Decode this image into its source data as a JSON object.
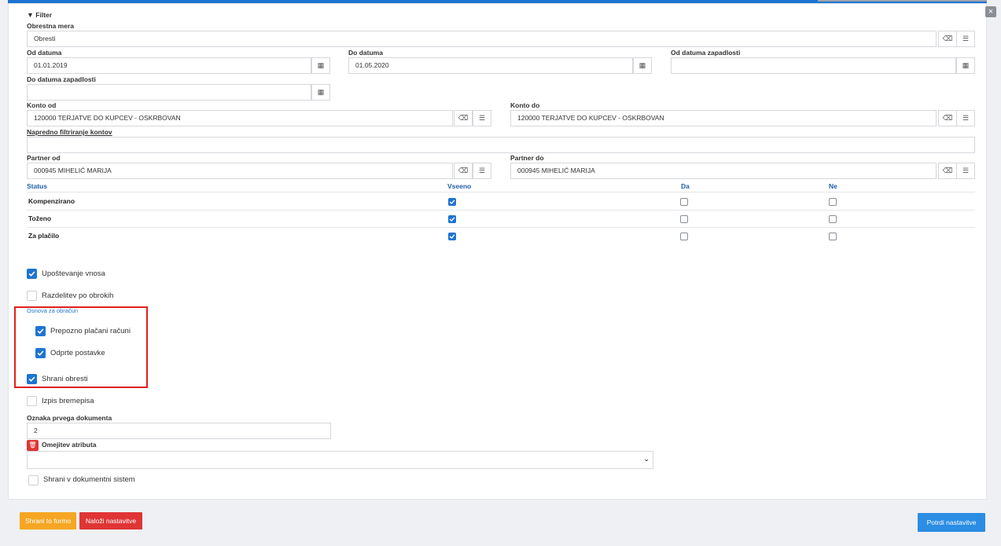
{
  "window": {
    "close_label": "×"
  },
  "filter": {
    "header": "Filter",
    "obrestna_mera": {
      "label": "Obrestna mera",
      "value": "Obresti"
    },
    "od_datuma": {
      "label": "Od datuma",
      "value": "01.01.2019"
    },
    "do_datuma": {
      "label": "Do datuma",
      "value": "01.05.2020"
    },
    "od_datuma_zapadlosti": {
      "label": "Od datuma zapadlosti",
      "value": ""
    },
    "do_datuma_zapadlosti": {
      "label": "Do datuma zapadlosti",
      "value": ""
    },
    "konto_od": {
      "label": "Konto od",
      "value": "120000 TERJATVE DO KUPCEV - OSKRBOVAN"
    },
    "konto_do": {
      "label": "Konto do",
      "value": "120000 TERJATVE DO KUPCEV - OSKRBOVAN"
    },
    "napredno": {
      "label": "Napredno filtriranje kontov",
      "value": ""
    },
    "partner_od": {
      "label": "Partner od",
      "value": "000945 MIHELIĆ MARIJA"
    },
    "partner_do": {
      "label": "Partner do",
      "value": "000945 MIHELIĆ MARIJA"
    }
  },
  "status_table": {
    "headers": {
      "status": "Status",
      "vseeno": "Vseeno",
      "da": "Da",
      "ne": "Ne"
    },
    "rows": [
      {
        "label": "Kompenzirano",
        "vseeno": true,
        "da": false,
        "ne": false
      },
      {
        "label": "Toženo",
        "vseeno": true,
        "da": false,
        "ne": false
      },
      {
        "label": "Za plačilo",
        "vseeno": true,
        "da": false,
        "ne": false
      }
    ]
  },
  "options": {
    "upostevanje": {
      "label": "Upoštevanje vnosa",
      "checked": true
    },
    "razdelitev": {
      "label": "Razdelitev po obrokih",
      "checked": false
    },
    "osnova_header": "Osnova za obračun",
    "prepozno": {
      "label": "Prepozno plačani računi",
      "checked": true
    },
    "odprte": {
      "label": "Odprte postavke",
      "checked": true
    },
    "shrani_obresti": {
      "label": "Shrani obresti",
      "checked": true
    },
    "izpis": {
      "label": "Izpis bremepisa",
      "checked": false
    },
    "oznaka": {
      "label": "Oznaka prvega dokumenta",
      "value": "2"
    },
    "omejitev": {
      "label": "Omejitev atributa",
      "value": ""
    },
    "shrani_dms": {
      "label": "Shrani v dokumentni sistem",
      "checked": false
    }
  },
  "footer": {
    "save_form": "Shrani to formo",
    "load_settings": "Naloži nastavitve",
    "confirm": "Potrdi nastavitve"
  },
  "colors": {
    "accent": "#1e74d2",
    "highlight": "#e02020",
    "save_btn": "#f5a623",
    "load_btn": "#e03535",
    "confirm_btn": "#2b8de3"
  }
}
